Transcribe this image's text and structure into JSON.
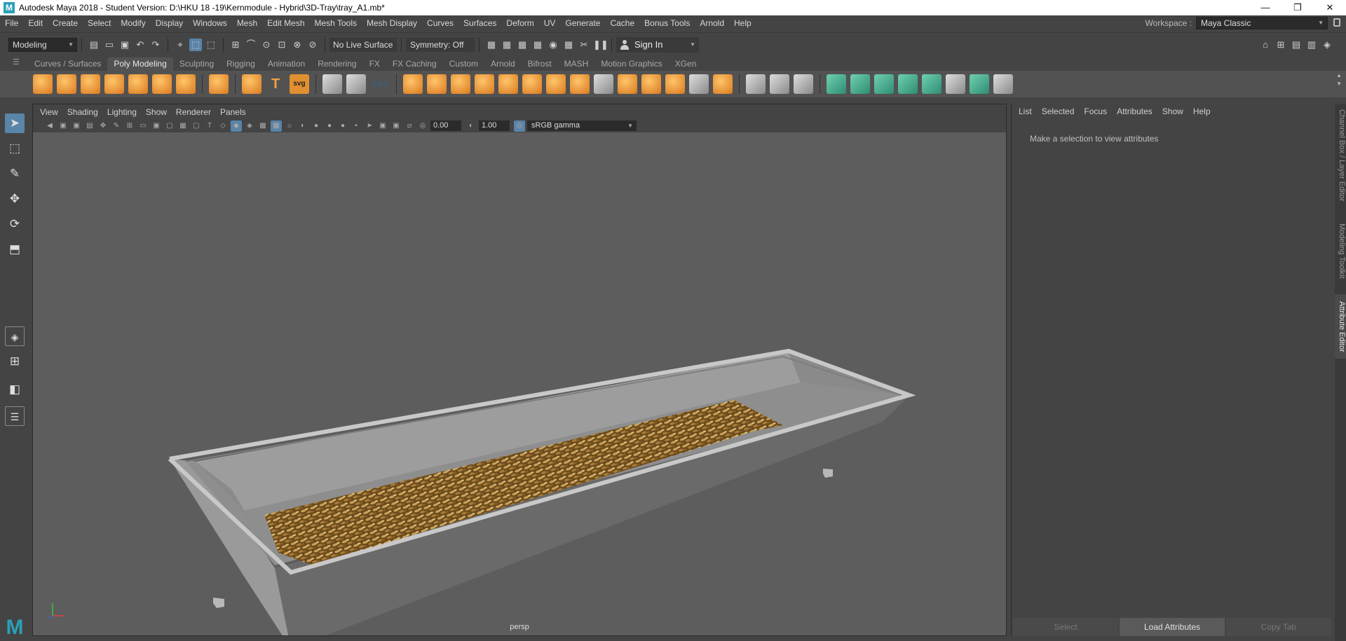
{
  "window": {
    "title": "Autodesk Maya 2018 - Student Version: D:\\HKU 18 -19\\Kernmodule - Hybrid\\3D-Tray\\tray_A1.mb*",
    "logo": "M",
    "minimize": "—",
    "restore": "❐",
    "close": "✕"
  },
  "menus": [
    "File",
    "Edit",
    "Create",
    "Select",
    "Modify",
    "Display",
    "Windows",
    "Mesh",
    "Edit Mesh",
    "Mesh Tools",
    "Mesh Display",
    "Curves",
    "Surfaces",
    "Deform",
    "UV",
    "Generate",
    "Cache",
    "Bonus Tools",
    "Arnold",
    "Help"
  ],
  "workspace": {
    "label": "Workspace :",
    "value": "Maya Classic"
  },
  "statusline": {
    "mode": "Modeling",
    "live_surface": "No Live Surface",
    "symmetry": "Symmetry: Off",
    "sign_in": "Sign In"
  },
  "shelf_tabs": [
    "Curves / Surfaces",
    "Poly Modeling",
    "Sculpting",
    "Rigging",
    "Animation",
    "Rendering",
    "FX",
    "FX Caching",
    "Custom",
    "Arnold",
    "Bifrost",
    "MASH",
    "Motion Graphics",
    "XGen"
  ],
  "active_shelf": "Poly Modeling",
  "shelf_text_icons": {
    "type": "T",
    "svg": "svg",
    "pos": "0,0,0"
  },
  "viewport": {
    "menus": [
      "View",
      "Shading",
      "Lighting",
      "Show",
      "Renderer",
      "Panels"
    ],
    "exposure": "0.00",
    "gamma_value": "1.00",
    "color_space": "sRGB gamma",
    "camera": "persp"
  },
  "attribute_editor": {
    "menus": [
      "List",
      "Selected",
      "Focus",
      "Attributes",
      "Show",
      "Help"
    ],
    "message": "Make a selection to view attributes",
    "buttons": {
      "select": "Select",
      "load": "Load Attributes",
      "copy_tab": "Copy Tab"
    }
  },
  "side_tabs": {
    "channel_box": "Channel Box / Layer Editor",
    "modeling_toolkit": "Modeling Toolkit",
    "attribute_editor": "Attribute Editor"
  },
  "colors": {
    "accent": "#5a84a8",
    "maya_teal": "#2aa0b8",
    "viewport_bg": "#5d5d5d",
    "ui_bg": "#444444"
  }
}
